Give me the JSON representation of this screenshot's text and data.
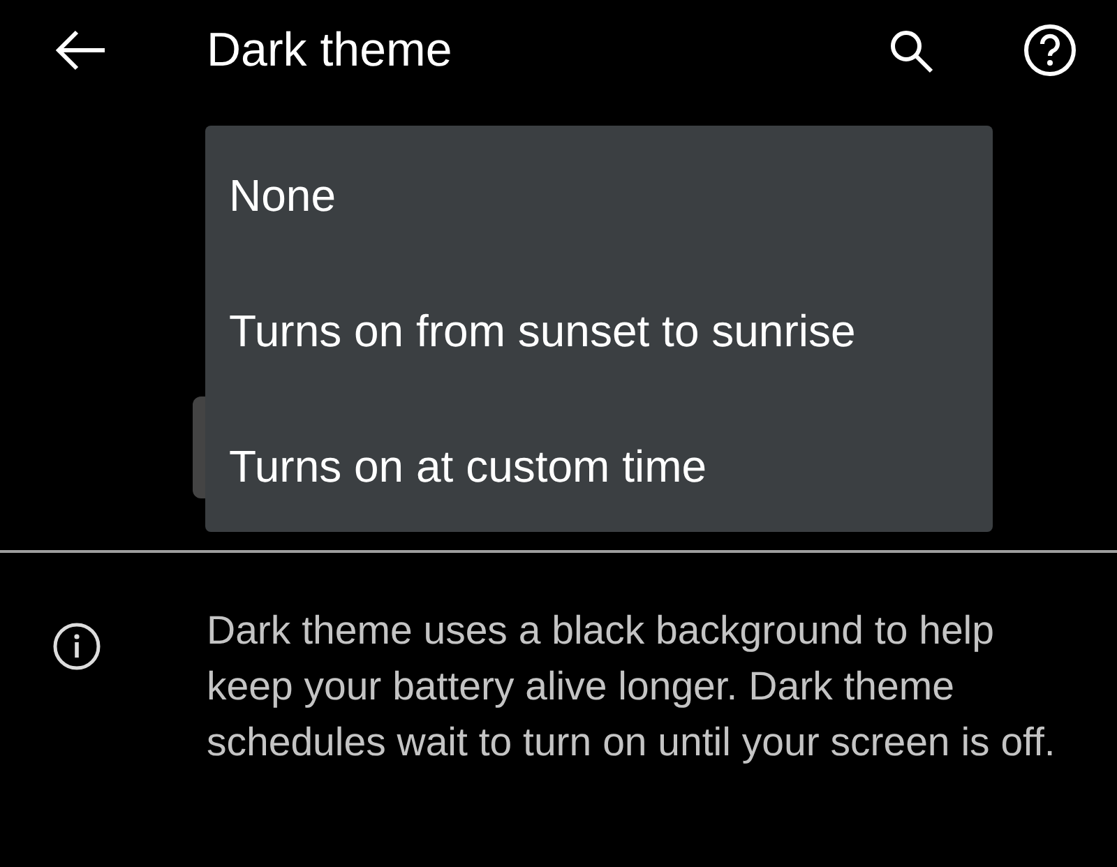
{
  "app_bar": {
    "title": "Dark theme"
  },
  "menu": {
    "items": [
      {
        "label": "None"
      },
      {
        "label": "Turns on from sunset to sunrise"
      },
      {
        "label": "Turns on at custom time"
      }
    ]
  },
  "info": {
    "text": "Dark theme uses a black background to help keep your battery alive longer. Dark theme schedules wait to turn on until your screen is off."
  }
}
